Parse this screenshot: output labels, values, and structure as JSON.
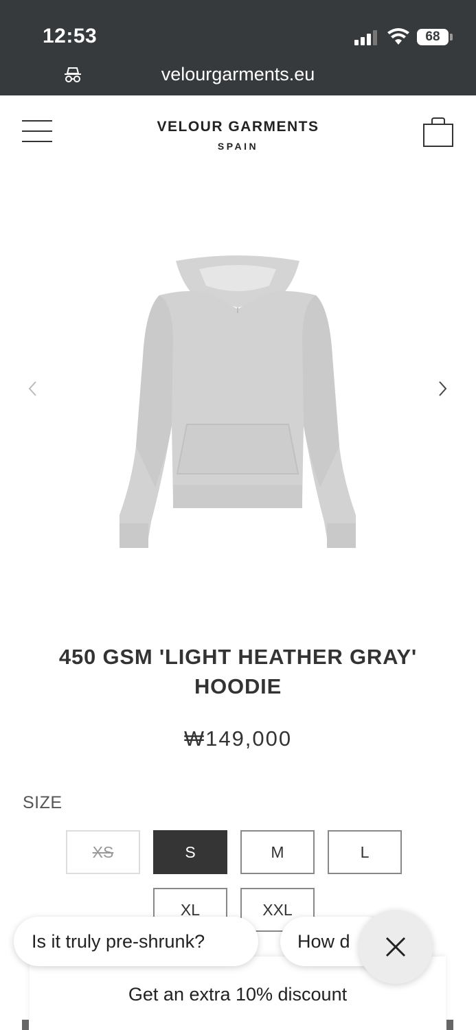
{
  "status_bar": {
    "time": "12:53",
    "battery": "68",
    "icons": [
      "signal-icon",
      "wifi-icon",
      "battery-icon"
    ]
  },
  "browser": {
    "url": "velourgarments.eu",
    "privacy_icon": "incognito-icon"
  },
  "header": {
    "brand_name": "VELOUR GARMENTS",
    "brand_sub": "SPAIN",
    "menu_icon": "hamburger-menu-icon",
    "cart_icon": "shopping-bag-icon"
  },
  "product": {
    "image": "light-heather-gray-hoodie",
    "title": "450 GSM 'LIGHT HEATHER GRAY' HOODIE",
    "price": "₩149,000",
    "size_label": "SIZE",
    "sizes": [
      {
        "label": "XS",
        "state": "unavailable"
      },
      {
        "label": "S",
        "state": "selected"
      },
      {
        "label": "M",
        "state": "available"
      },
      {
        "label": "L",
        "state": "available"
      },
      {
        "label": "XL",
        "state": "available"
      },
      {
        "label": "XXL",
        "state": "available"
      }
    ]
  },
  "chat": {
    "suggestions": [
      "Is it truly pre-shrunk?",
      "How d"
    ],
    "close_icon": "close-icon",
    "discount_text": "Get an extra 10% discount"
  },
  "colors": {
    "chrome": "#373a3c",
    "selected": "#353535",
    "text": "#333333"
  }
}
